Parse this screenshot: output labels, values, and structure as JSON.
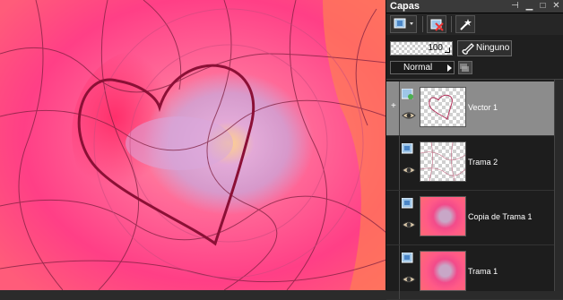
{
  "panel": {
    "title": "Capas",
    "controls": [
      "pin-icon",
      "minimize-icon",
      "restore-icon",
      "close-icon"
    ]
  },
  "toolbar": {
    "buttons": [
      "new-layer-icon",
      "delete-layer-icon",
      "effects-icon"
    ]
  },
  "opacity": {
    "value": "100"
  },
  "mask": {
    "label": "Ninguno"
  },
  "blend": {
    "mode": "Normal"
  },
  "layers": [
    {
      "name": "Vector 1",
      "type": "vector",
      "visible": true,
      "selected": true,
      "expandable": true,
      "thumbnail": "transparent-heart"
    },
    {
      "name": "Trama 2",
      "type": "raster",
      "visible": true,
      "selected": false,
      "expandable": false,
      "thumbnail": "transparent-lines"
    },
    {
      "name": "Copia de Trama 1",
      "type": "raster",
      "visible": true,
      "selected": false,
      "expandable": false,
      "thumbnail": "pink-gradient"
    },
    {
      "name": "Trama 1",
      "type": "raster",
      "visible": true,
      "selected": false,
      "expandable": false,
      "thumbnail": "pink-gradient"
    }
  ],
  "colors": {
    "canvas_primary": "#ff4f8f",
    "canvas_secondary": "#ff7a4e",
    "heart_stroke": "#8b1036",
    "selected_row": "#8c8c8c",
    "panel_bg": "#1f1f1f"
  }
}
